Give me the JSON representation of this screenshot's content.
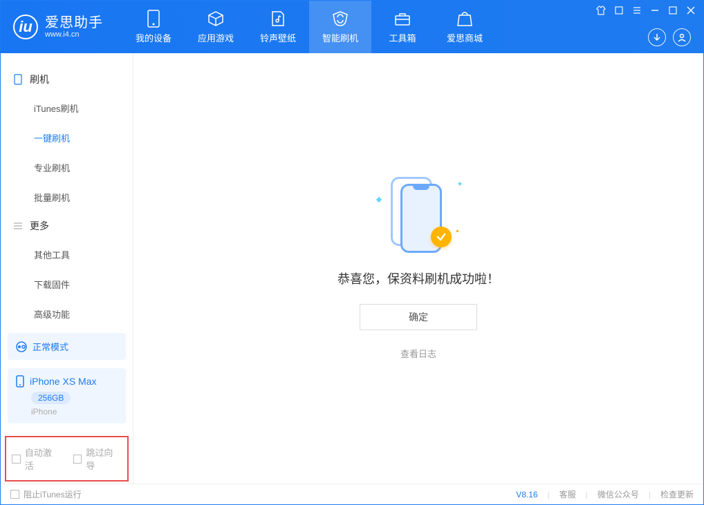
{
  "app": {
    "title": "爱思助手",
    "subtitle": "www.i4.cn"
  },
  "tabs": [
    {
      "label": "我的设备"
    },
    {
      "label": "应用游戏"
    },
    {
      "label": "铃声壁纸"
    },
    {
      "label": "智能刷机"
    },
    {
      "label": "工具箱"
    },
    {
      "label": "爱思商城"
    }
  ],
  "sidebar": {
    "section1": {
      "title": "刷机",
      "items": [
        "iTunes刷机",
        "一键刷机",
        "专业刷机",
        "批量刷机"
      ]
    },
    "section2": {
      "title": "更多",
      "items": [
        "其他工具",
        "下载固件",
        "高级功能"
      ]
    },
    "mode": "正常模式",
    "device": {
      "name": "iPhone XS Max",
      "capacity": "256GB",
      "type": "iPhone"
    },
    "checks": {
      "c1": "自动激活",
      "c2": "跳过向导"
    }
  },
  "main": {
    "message": "恭喜您，保资料刷机成功啦！",
    "ok": "确定",
    "log": "查看日志"
  },
  "footer": {
    "stop_itunes": "阻止iTunes运行",
    "version": "V8.16",
    "links": [
      "客服",
      "微信公众号",
      "检查更新"
    ]
  }
}
